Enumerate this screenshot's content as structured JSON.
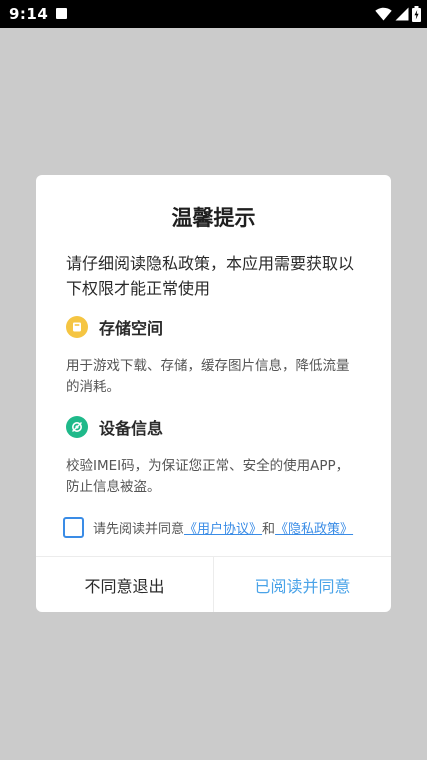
{
  "status_bar": {
    "time": "9:14"
  },
  "dialog": {
    "title": "温馨提示",
    "intro": "请仔细阅读隐私政策，本应用需要获取以下权限才能正常使用",
    "permissions": [
      {
        "icon": "storage-icon",
        "icon_color": "#f5c542",
        "title": "存储空间",
        "description": "用于游戏下载、存储，缓存图片信息，降低流量的消耗。"
      },
      {
        "icon": "device-info-icon",
        "icon_color": "#1fb98a",
        "title": "设备信息",
        "description": "校验IMEI码，为保证您正常、安全的使用APP，防止信息被盗。"
      }
    ],
    "agreement": {
      "prefix": "请先阅读并同意",
      "user_agreement": "《用户协议》",
      "and": "和",
      "privacy_policy": "《隐私政策》"
    },
    "buttons": {
      "disagree": "不同意退出",
      "agree": "已阅读并同意"
    }
  },
  "colors": {
    "accent": "#3a8ce6",
    "agree_button": "#4aa3e8",
    "backdrop": "#cbcbcb"
  }
}
